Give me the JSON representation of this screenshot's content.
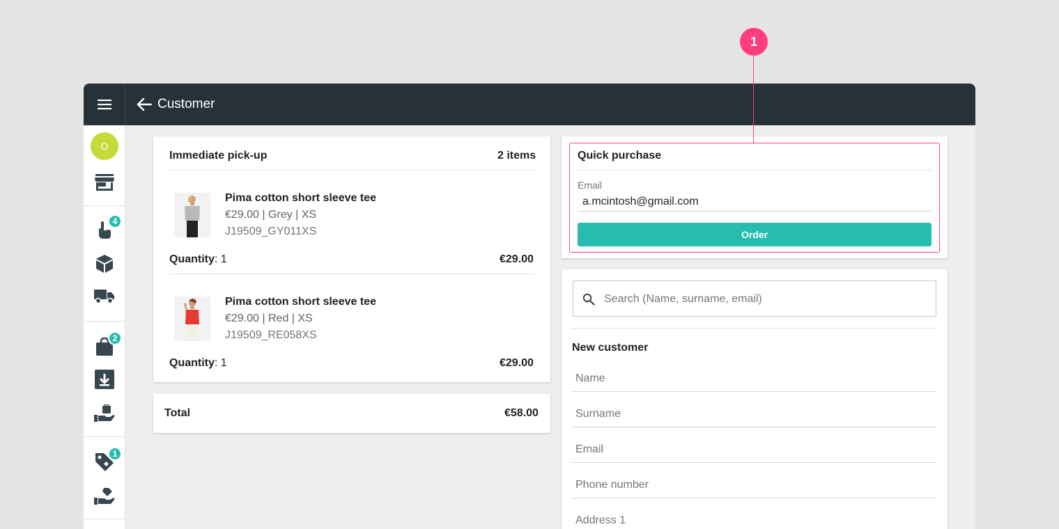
{
  "callout": {
    "number": "1"
  },
  "header": {
    "title": "Customer"
  },
  "sidebar": {
    "avatar_initial": "O",
    "badges": {
      "pick": "4",
      "bag": "2",
      "tag": "1"
    }
  },
  "pickup": {
    "title": "Immediate pick-up",
    "count": "2 items",
    "quantity_label": "Quantity",
    "items": [
      {
        "name": "Pima cotton short sleeve tee",
        "variant": "€29.00 | Grey | XS",
        "sku": "J19509_GY011XS",
        "quantity": ": 1",
        "price": "€29.00",
        "shirt_color": "#b9b9b9"
      },
      {
        "name": "Pima cotton short sleeve tee",
        "variant": "€29.00 | Red | XS",
        "sku": "J19509_RE058XS",
        "quantity": ": 1",
        "price": "€29.00",
        "shirt_color": "#e53935"
      }
    ]
  },
  "total": {
    "label": "Total",
    "amount": "€58.00"
  },
  "quick_purchase": {
    "title": "Quick purchase",
    "email_label": "Email",
    "email_value": "a.mcintosh@gmail.com",
    "order_label": "Order"
  },
  "customer": {
    "search_placeholder": "Search (Name, surname, email)",
    "new_title": "New customer",
    "fields": [
      "Name",
      "Surname",
      "Email",
      "Phone number",
      "Address 1"
    ]
  },
  "colors": {
    "accent": "#26bcae",
    "callout": "#ff3d7f",
    "topbar": "#263238",
    "avatar": "#c6db3a"
  }
}
